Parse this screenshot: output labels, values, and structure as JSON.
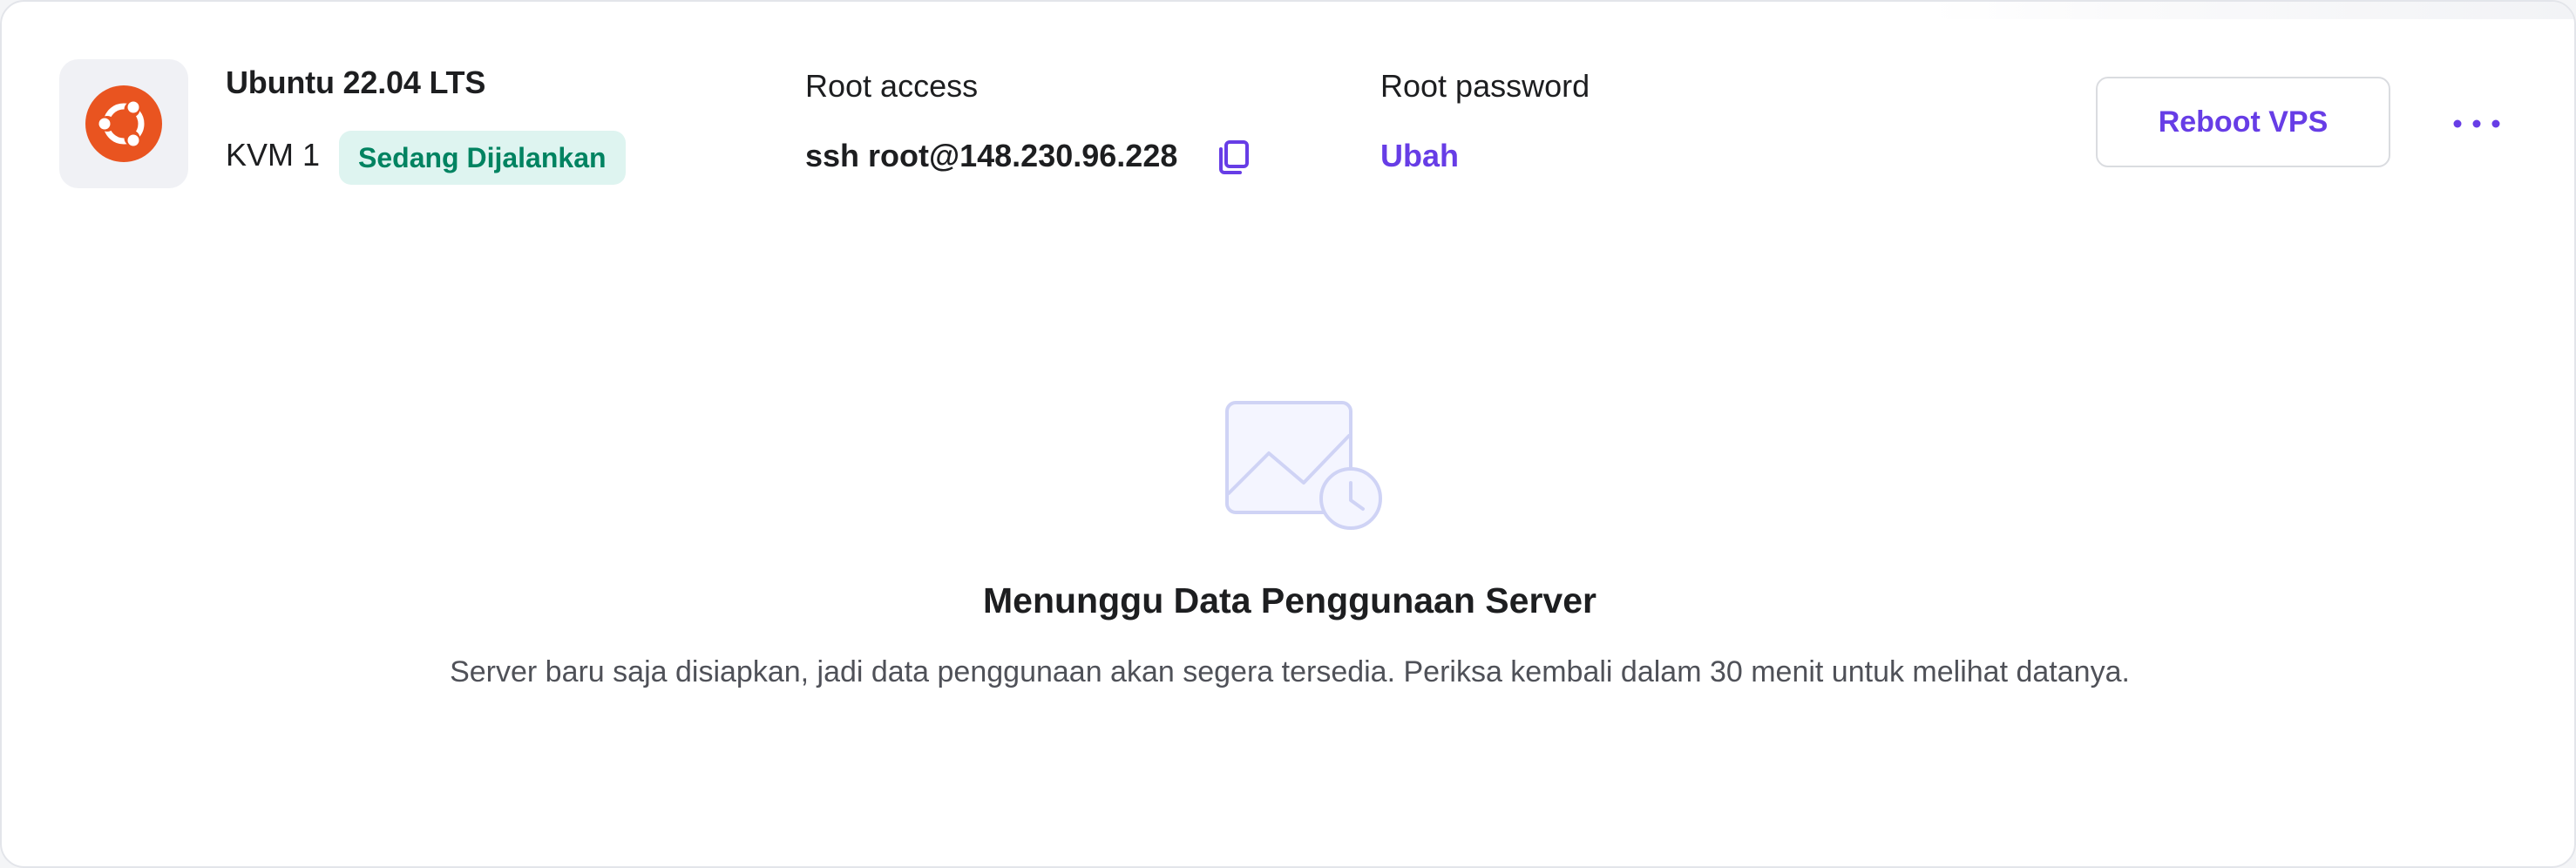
{
  "server": {
    "os_name": "Ubuntu 22.04 LTS",
    "os_icon": "ubuntu-logo-icon",
    "plan": "KVM 1",
    "status": "Sedang Dijalankan"
  },
  "root_access": {
    "label": "Root access",
    "command": "ssh root@148.230.96.228",
    "copy_icon": "copy-icon"
  },
  "root_password": {
    "label": "Root password",
    "action": "Ubah"
  },
  "actions": {
    "reboot_label": "Reboot VPS",
    "more_icon": "more-options-icon"
  },
  "empty_state": {
    "icon": "chart-clock-icon",
    "title": "Menunggu Data Penggunaan Server",
    "description": "Server baru saja disiapkan, jadi data penggunaan akan segera tersedia. Periksa kembali dalam 30 menit untuk melihat datanya."
  },
  "colors": {
    "accent": "#673de6",
    "status_bg": "#def4f0",
    "status_text": "#008361",
    "ubuntu_orange": "#e95420"
  }
}
